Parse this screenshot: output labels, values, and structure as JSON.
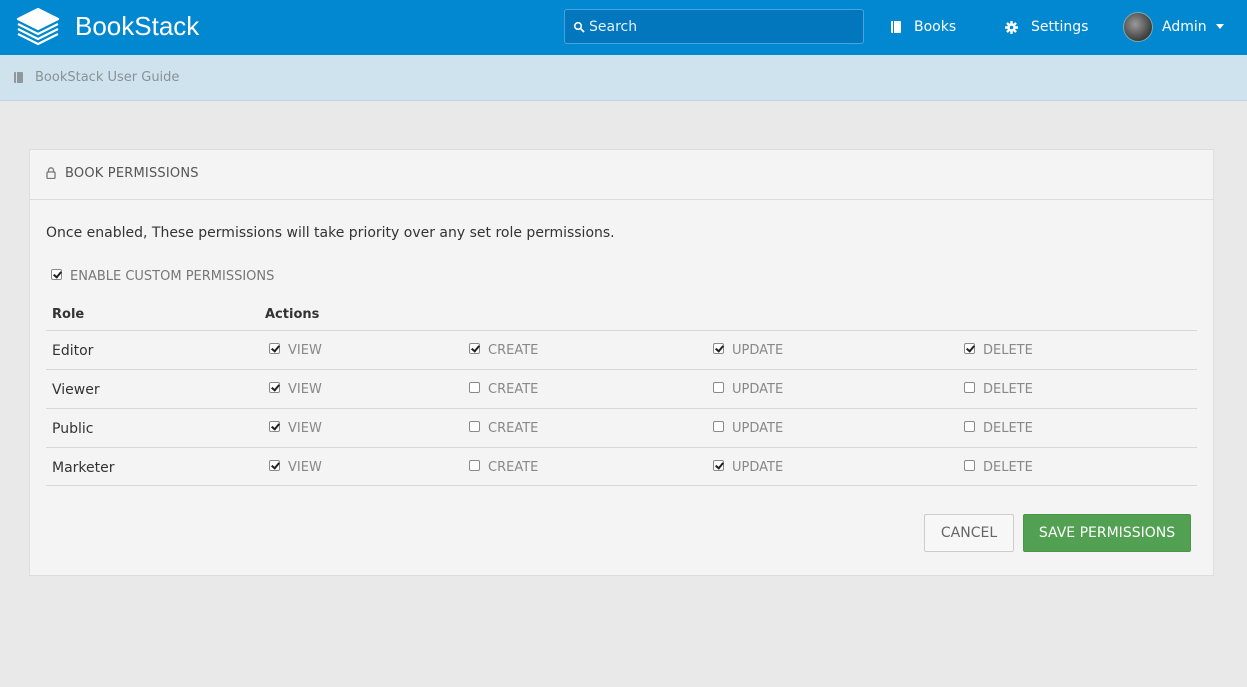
{
  "header": {
    "brand": "BookStack",
    "search_placeholder": "Search",
    "nav": {
      "books": "Books",
      "settings": "Settings"
    },
    "user": {
      "name": "Admin"
    },
    "colors": {
      "bar": "#0288d1"
    }
  },
  "breadcrumb": {
    "item": "BookStack User Guide"
  },
  "card": {
    "title": "BOOK PERMISSIONS",
    "intro": "Once enabled, These permissions will take priority over any set role permissions.",
    "enable_label": "ENABLE CUSTOM PERMISSIONS",
    "enable_checked": true,
    "headers": {
      "role": "Role",
      "actions": "Actions"
    },
    "action_labels": [
      "VIEW",
      "CREATE",
      "UPDATE",
      "DELETE"
    ],
    "rows": [
      {
        "role": "Editor",
        "perms": [
          true,
          true,
          true,
          true
        ]
      },
      {
        "role": "Viewer",
        "perms": [
          true,
          false,
          false,
          false
        ]
      },
      {
        "role": "Public",
        "perms": [
          true,
          false,
          false,
          false
        ]
      },
      {
        "role": "Marketer",
        "perms": [
          true,
          false,
          true,
          false
        ]
      }
    ],
    "buttons": {
      "cancel": "CANCEL",
      "save": "SAVE PERMISSIONS"
    }
  }
}
